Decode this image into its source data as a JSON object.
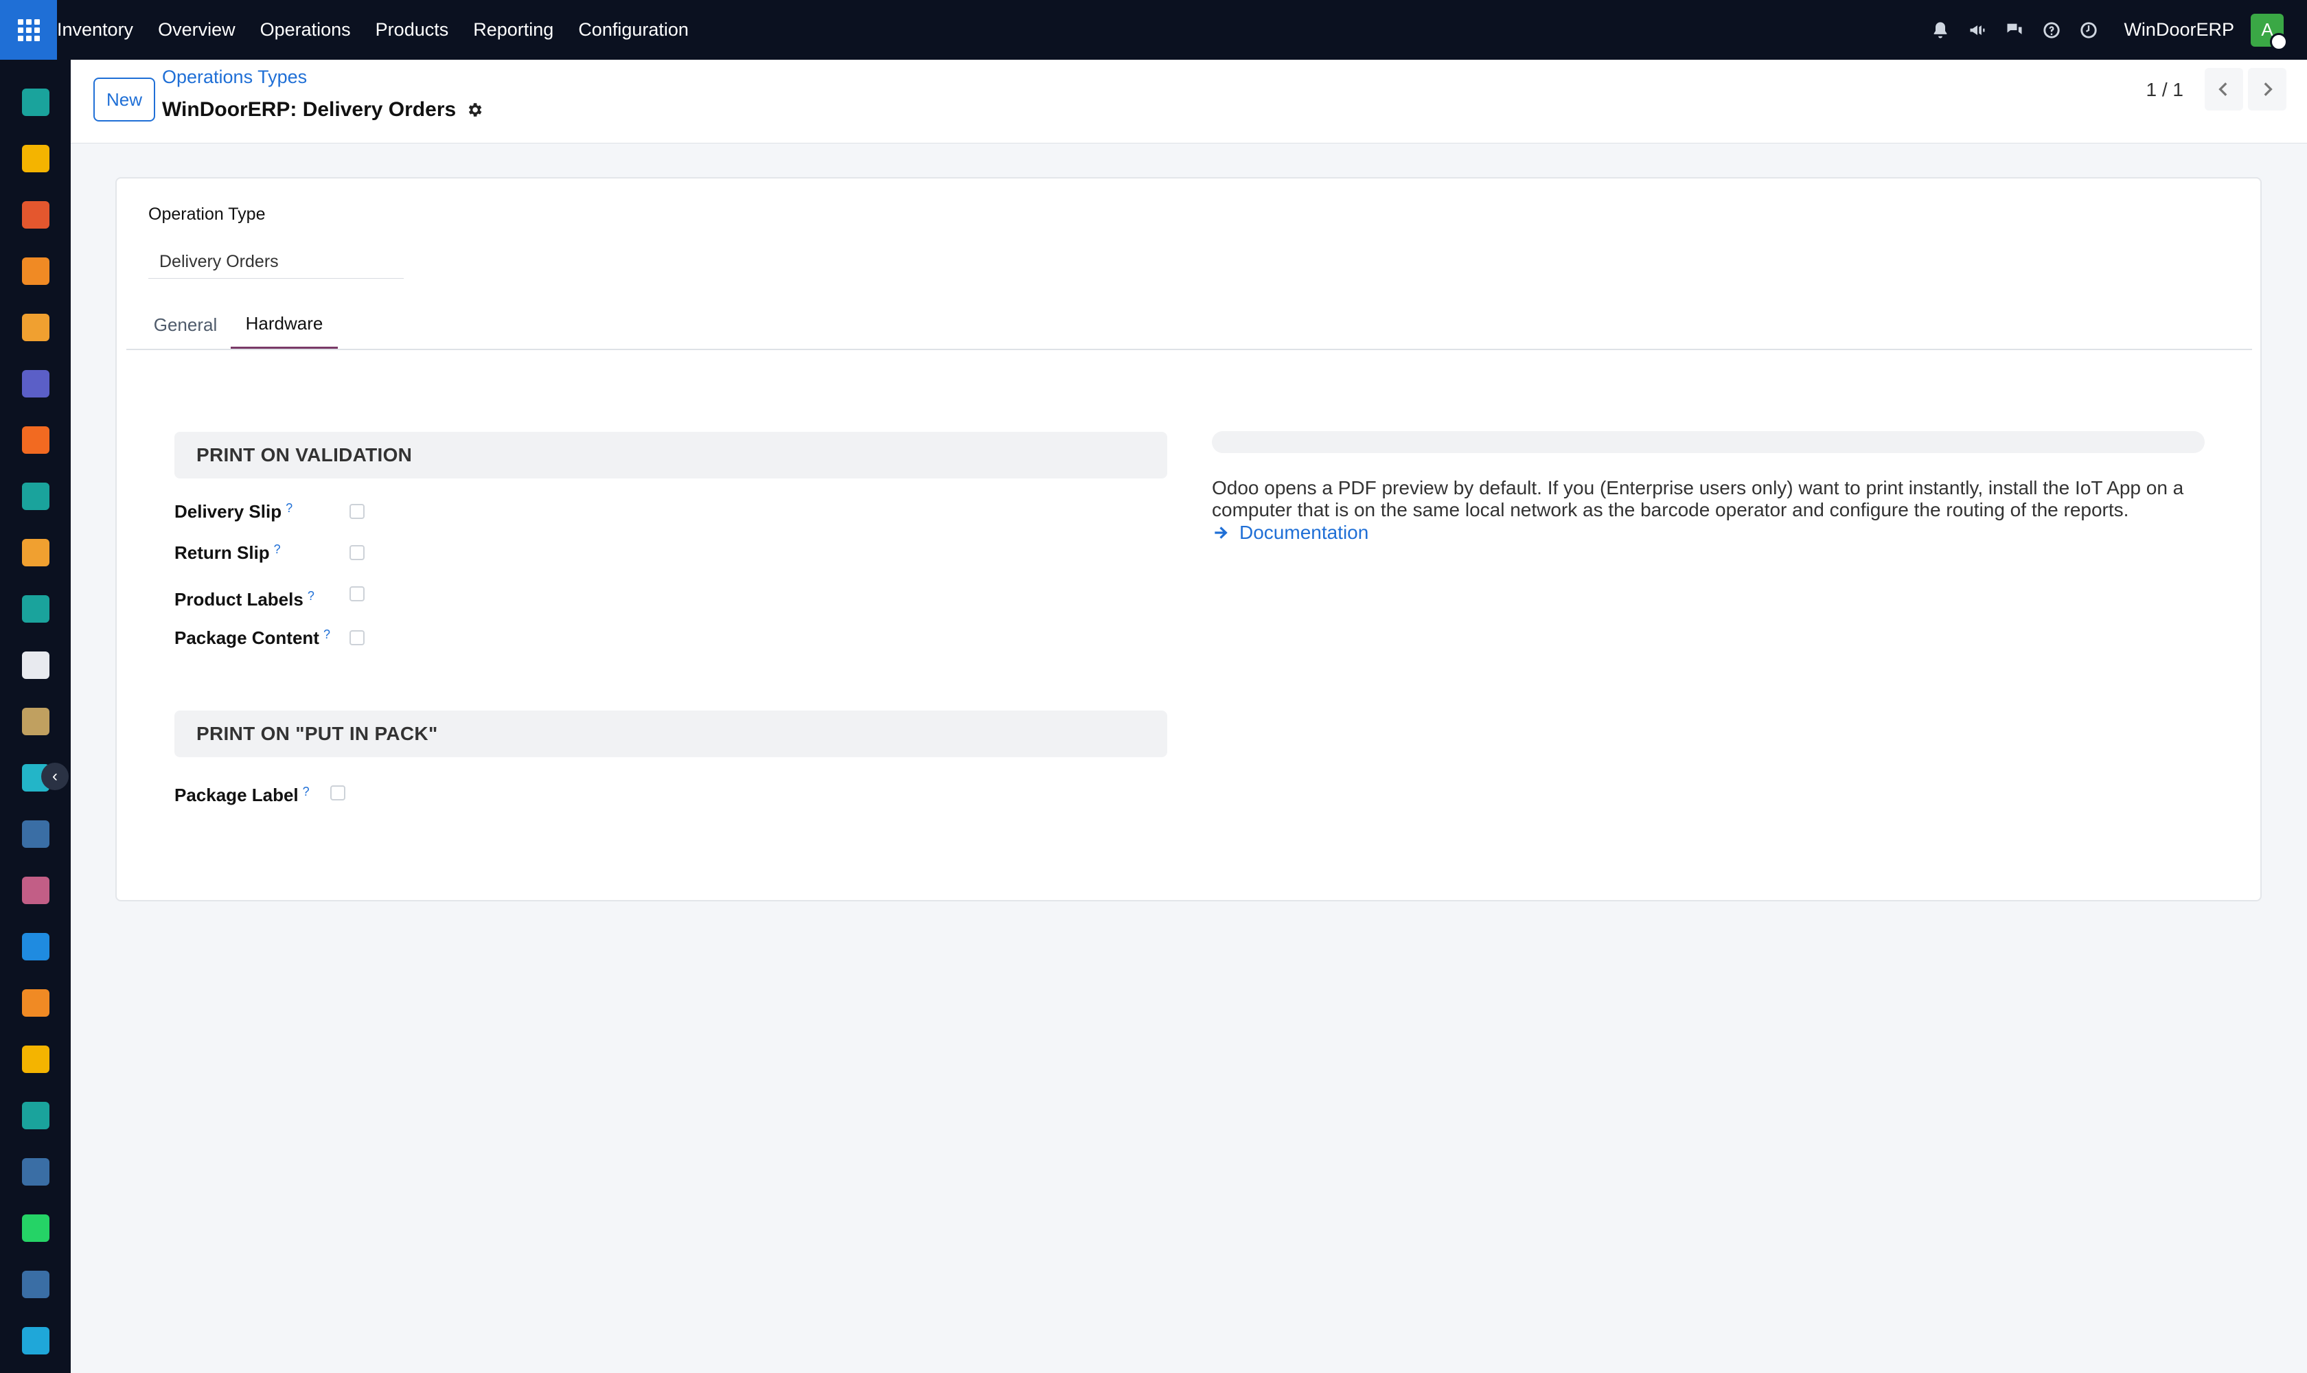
{
  "navbar": {
    "brand": "Inventory",
    "menu": [
      "Overview",
      "Operations",
      "Products",
      "Reporting",
      "Configuration"
    ],
    "company": "WinDoorERP",
    "avatar_letter": "A",
    "icons": [
      "bell-icon",
      "megaphone-icon",
      "chat-icon",
      "help-icon",
      "clock-icon"
    ]
  },
  "sidebar_apps": [
    {
      "name": "tag-app-icon",
      "color": "#1aa39c"
    },
    {
      "name": "paper-plane-app-icon",
      "color": "#f4b400"
    },
    {
      "name": "pie-app-icon",
      "color": "#e4572e"
    },
    {
      "name": "gear-app-icon",
      "color": "#f08a24"
    },
    {
      "name": "bar-app-icon",
      "color": "#f0a030"
    },
    {
      "name": "mail-app-icon",
      "color": "#5b5fc7"
    },
    {
      "name": "bubble-app-icon",
      "color": "#f26a21"
    },
    {
      "name": "tag2-app-icon",
      "color": "#1aa39c"
    },
    {
      "name": "bars2-app-icon",
      "color": "#f0a030"
    },
    {
      "name": "contacts-app-icon",
      "color": "#1aa39c"
    },
    {
      "name": "box-app-icon",
      "color": "#e8eaef"
    },
    {
      "name": "pencil-app-icon",
      "color": "#c0a060"
    },
    {
      "name": "check-app-icon",
      "color": "#23b5c8"
    },
    {
      "name": "book-app-icon",
      "color": "#3a6ea5"
    },
    {
      "name": "cube-app-icon",
      "color": "#c25e86"
    },
    {
      "name": "invoice-app-icon",
      "color": "#1f8be0"
    },
    {
      "name": "people-app-icon",
      "color": "#f08a24"
    },
    {
      "name": "calendar-app-icon",
      "color": "#f4b400"
    },
    {
      "name": "sign-app-icon",
      "color": "#1aa39c"
    },
    {
      "name": "dashboard-app-icon",
      "color": "#3a6ea5"
    },
    {
      "name": "whatsapp-app-icon",
      "color": "#25d366"
    },
    {
      "name": "clock-app-icon",
      "color": "#3a6ea5"
    },
    {
      "name": "wave-app-icon",
      "color": "#1fa7d9"
    }
  ],
  "control": {
    "new_label": "New",
    "breadcrumb": "Operations Types",
    "record_title": "WinDoorERP: Delivery Orders",
    "pager": "1 / 1"
  },
  "form": {
    "operation_type_label": "Operation Type",
    "operation_type_value": "Delivery Orders",
    "tabs": [
      "General",
      "Hardware"
    ],
    "section_validation": "PRINT ON VALIDATION",
    "validation_fields": [
      "Delivery Slip",
      "Return Slip",
      "Product Labels",
      "Package Content"
    ],
    "section_pack": "PRINT ON \"PUT IN PACK\"",
    "pack_fields": [
      "Package Label"
    ],
    "help_mark": "?",
    "info_text": "Odoo opens a PDF preview by default. If you (Enterprise users only) want to print instantly, install the IoT App on a computer that is on the same local network as the barcode operator and configure the routing of the reports.",
    "doc_link": "Documentation"
  }
}
